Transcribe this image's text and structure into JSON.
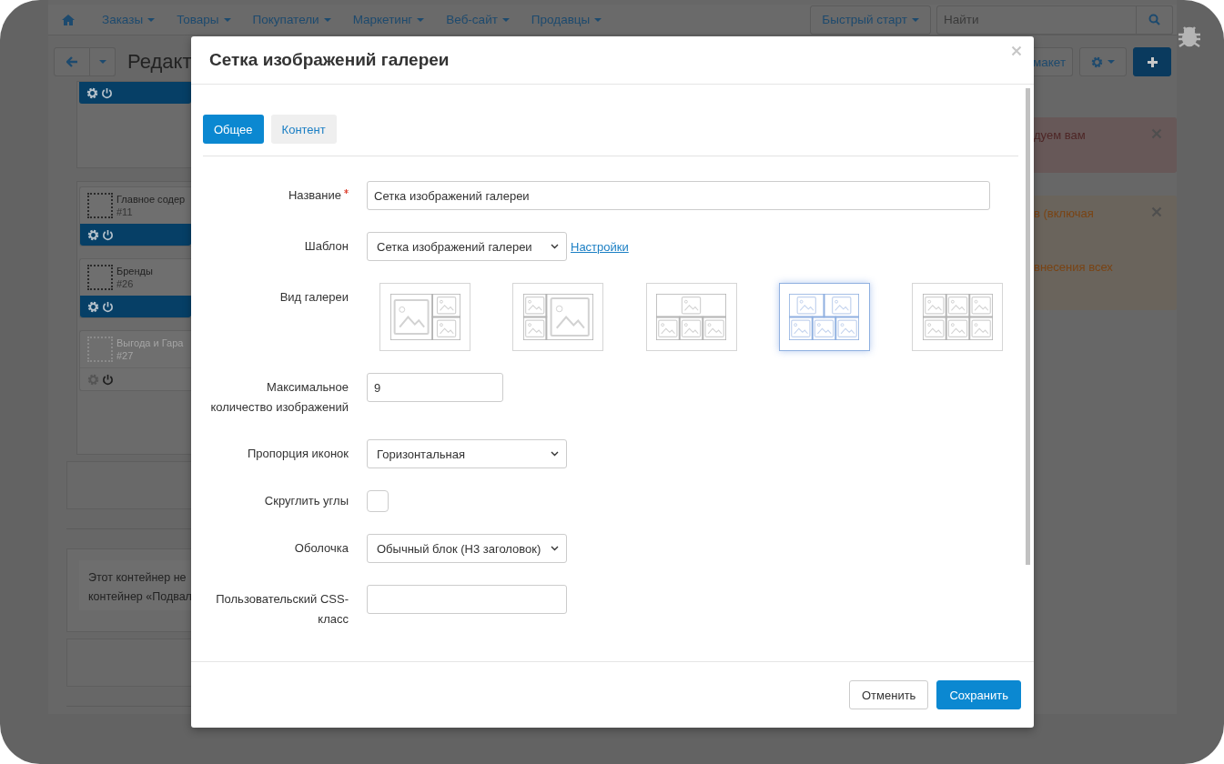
{
  "navbar": {
    "menus": [
      {
        "label": "Заказы"
      },
      {
        "label": "Товары"
      },
      {
        "label": "Покупатели"
      },
      {
        "label": "Маркетинг"
      },
      {
        "label": "Веб-сайт"
      },
      {
        "label": "Продавцы"
      }
    ],
    "quick_start": "Быстрый старт",
    "search": {
      "placeholder": "Найти"
    }
  },
  "toolbar": {
    "title": "Редакт",
    "layout_button": "макет"
  },
  "blocks": [
    {
      "title": "Главное содер",
      "id": "#11",
      "enabled": true
    },
    {
      "title": "Бренды",
      "id": "#26",
      "enabled": true
    },
    {
      "title": "Выгода и Гара",
      "id": "#27",
      "enabled": false
    }
  ],
  "container_note": [
    "Этот контейнер не",
    "контейнер «Подвал"
  ],
  "alerts": [
    {
      "kind": "danger",
      "lines": [
        "дуем вам"
      ]
    },
    {
      "kind": "warning",
      "lines": [
        "в (включая",
        "внесения всех"
      ]
    }
  ],
  "dialog": {
    "title": "Сетка изображений галереи",
    "tabs": [
      {
        "label": "Общее",
        "selected": true
      },
      {
        "label": "Контент",
        "selected": false
      }
    ],
    "fields": [
      {
        "kind": "text",
        "label": "Название",
        "required": true,
        "value": "Сетка изображений галереи",
        "wide": true
      },
      {
        "kind": "select",
        "label": "Шаблон",
        "value": "Сетка изображений галереи",
        "link": "Настройки"
      },
      {
        "kind": "gallery",
        "label": "Вид галереи",
        "options": [
          {
            "kind": "big-left",
            "selected": false
          },
          {
            "kind": "big-right",
            "selected": false
          },
          {
            "kind": "wide-top",
            "selected": false
          },
          {
            "kind": "two-three",
            "selected": true
          },
          {
            "kind": "grid",
            "selected": false
          }
        ]
      },
      {
        "kind": "number",
        "label": "Максимальное количество изображений",
        "value": "9"
      },
      {
        "kind": "select",
        "label": "Пропорция иконок",
        "value": "Горизонтальная"
      },
      {
        "kind": "checkbox",
        "label": "Скруглить углы",
        "checked": false
      },
      {
        "kind": "select",
        "label": "Оболочка",
        "value": "Обычный блок (H3 заголовок)"
      },
      {
        "kind": "text",
        "label": "Пользовательский CSS-класс",
        "wide": false
      }
    ],
    "buttons": [
      {
        "label": "Отменить",
        "kind": "default"
      },
      {
        "label": "Сохранить",
        "kind": "primary"
      }
    ]
  }
}
